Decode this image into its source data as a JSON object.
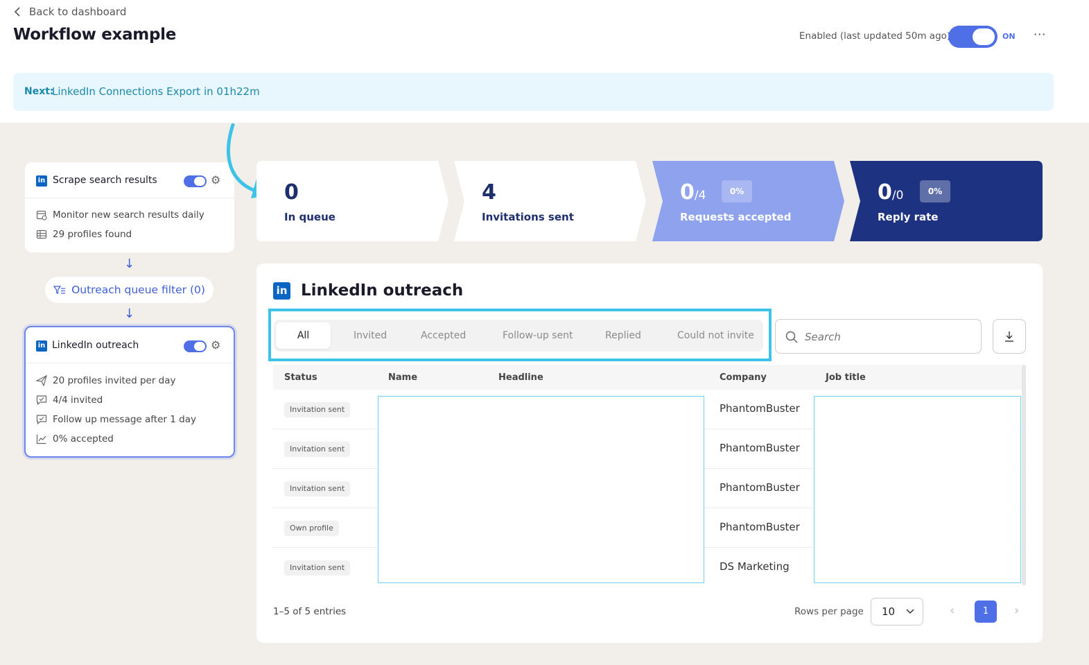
{
  "header": {
    "back_label": "Back to dashboard",
    "title": "Workflow example",
    "status_text": "Enabled (last updated 50m ago)",
    "toggle_label": "ON",
    "more_icon": "more-horizontal-icon"
  },
  "banner": {
    "prefix": "Next:",
    "text": "LinkedIn Connections Export in 01h22m"
  },
  "flow": {
    "scrape": {
      "title": "Scrape search results",
      "rows": [
        "Monitor new search results daily",
        "29 profiles found"
      ]
    },
    "filter_label": "Outreach queue filter (0)",
    "outreach": {
      "title": "LinkedIn outreach",
      "rows": [
        "20 profiles invited per day",
        "4/4 invited",
        "Follow up message after 1 day",
        "0% accepted"
      ]
    }
  },
  "stats": [
    {
      "value": "0",
      "label": "In queue"
    },
    {
      "value": "4",
      "label": "Invitations sent"
    },
    {
      "value": "0",
      "total": "/4",
      "pct": "0%",
      "label": "Requests accepted"
    },
    {
      "value": "0",
      "total": "/0",
      "pct": "0%",
      "label": "Reply rate"
    }
  ],
  "outreach_panel": {
    "title": "LinkedIn outreach",
    "tabs": [
      "All",
      "Invited",
      "Accepted",
      "Follow-up sent",
      "Replied",
      "Could not invite"
    ],
    "active_tab": "All",
    "search_placeholder": "Search",
    "columns": [
      "Status",
      "Name",
      "Headline",
      "Company",
      "Job title"
    ],
    "rows": [
      {
        "status": "Invitation sent",
        "company": "PhantomBuster"
      },
      {
        "status": "Invitation sent",
        "company": "PhantomBuster"
      },
      {
        "status": "Invitation sent",
        "company": "PhantomBuster"
      },
      {
        "status": "Own profile",
        "company": "PhantomBuster"
      },
      {
        "status": "Invitation sent",
        "company": "DS Marketing"
      }
    ],
    "entries_text": "1–5 of 5 entries",
    "rows_per_page_label": "Rows per page",
    "rows_per_page_value": "10",
    "current_page": "1"
  },
  "colors": {
    "accent": "#4f6fe6",
    "highlight": "#3ec3e8",
    "stat_light": "#8fa2ee",
    "stat_dark": "#1e3282",
    "linkedin": "#0a66c2"
  }
}
